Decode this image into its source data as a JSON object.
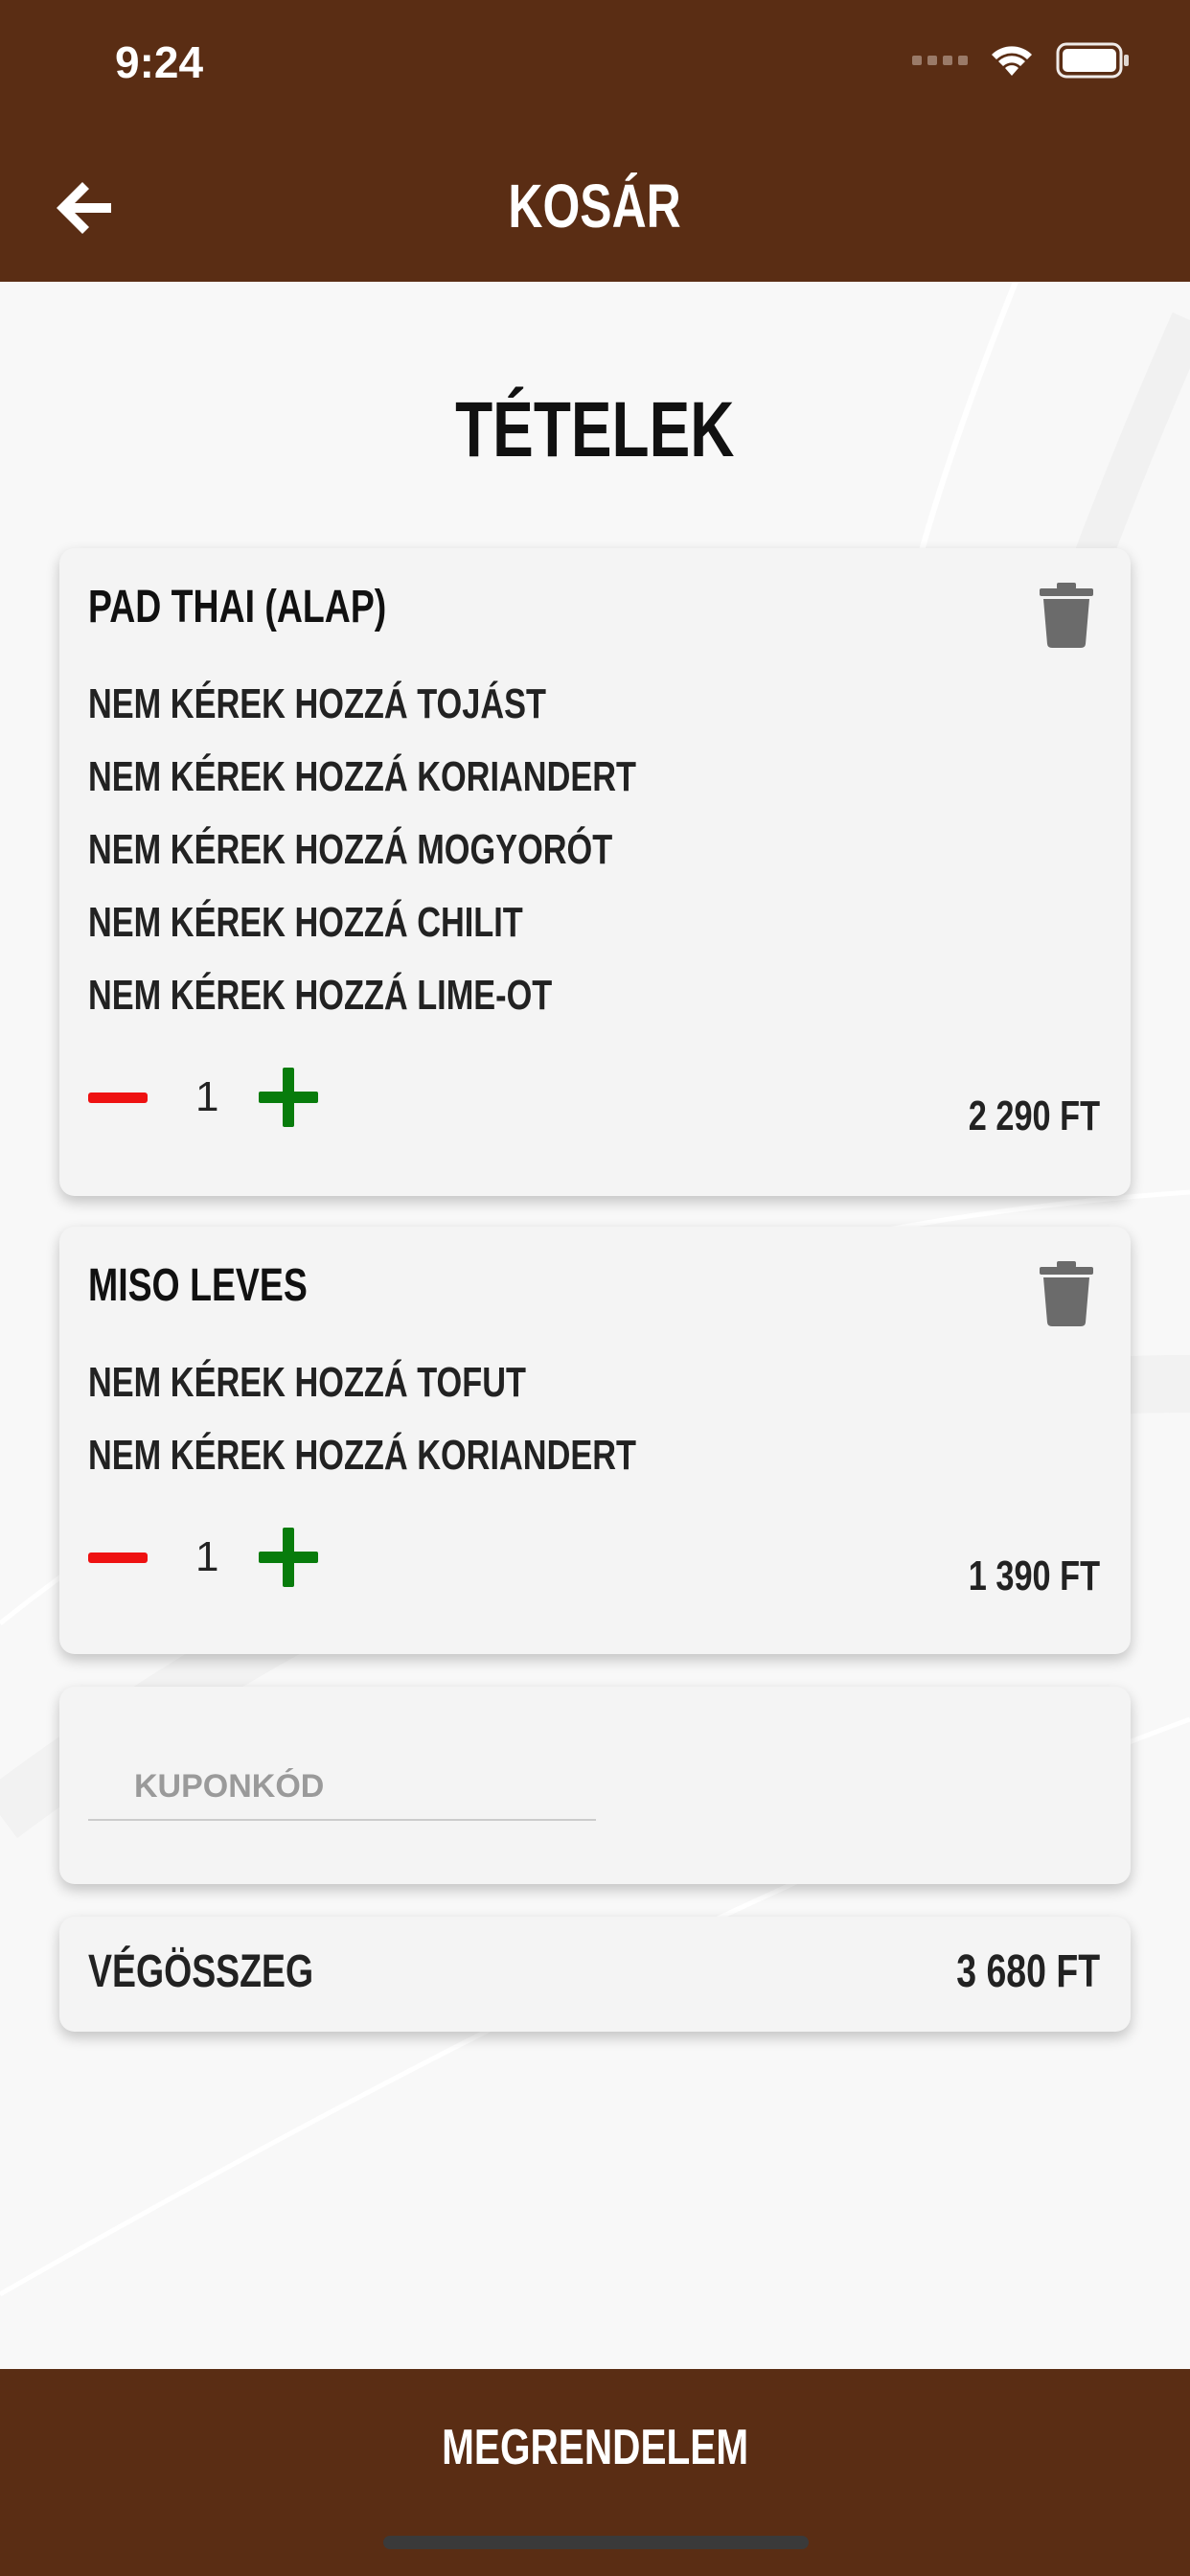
{
  "status_bar": {
    "time": "9:24",
    "icons": [
      "signal-icon",
      "wifi-icon",
      "battery-icon"
    ]
  },
  "header": {
    "title": "KOSÁR",
    "back_icon": "arrow-left-icon"
  },
  "section": {
    "title": "TÉTELEK"
  },
  "cart_items": [
    {
      "name": "PAD THAI (ALAP)",
      "options": [
        "NEM KÉREK HOZZÁ TOJÁST",
        "NEM KÉREK HOZZÁ KORIANDERT",
        "NEM KÉREK HOZZÁ MOGYORÓT",
        "NEM KÉREK HOZZÁ CHILIT",
        "NEM KÉREK HOZZÁ LIME-OT"
      ],
      "quantity": "1",
      "price": "2 290 FT"
    },
    {
      "name": "MISO LEVES",
      "options": [
        "NEM KÉREK HOZZÁ TOFUT",
        "NEM KÉREK HOZZÁ KORIANDERT"
      ],
      "quantity": "1",
      "price": "1 390 FT"
    }
  ],
  "coupon": {
    "placeholder": "KUPONKÓD",
    "value": ""
  },
  "total": {
    "label": "VÉGÖSSZEG",
    "value": "3 680 FT"
  },
  "footer": {
    "order_label": "MEGRENDELEM"
  },
  "colors": {
    "brand_brown": "#5a2d14",
    "minus_red": "#ee1111",
    "plus_green": "#087c0c",
    "trash_gray": "#6b6b6b"
  }
}
